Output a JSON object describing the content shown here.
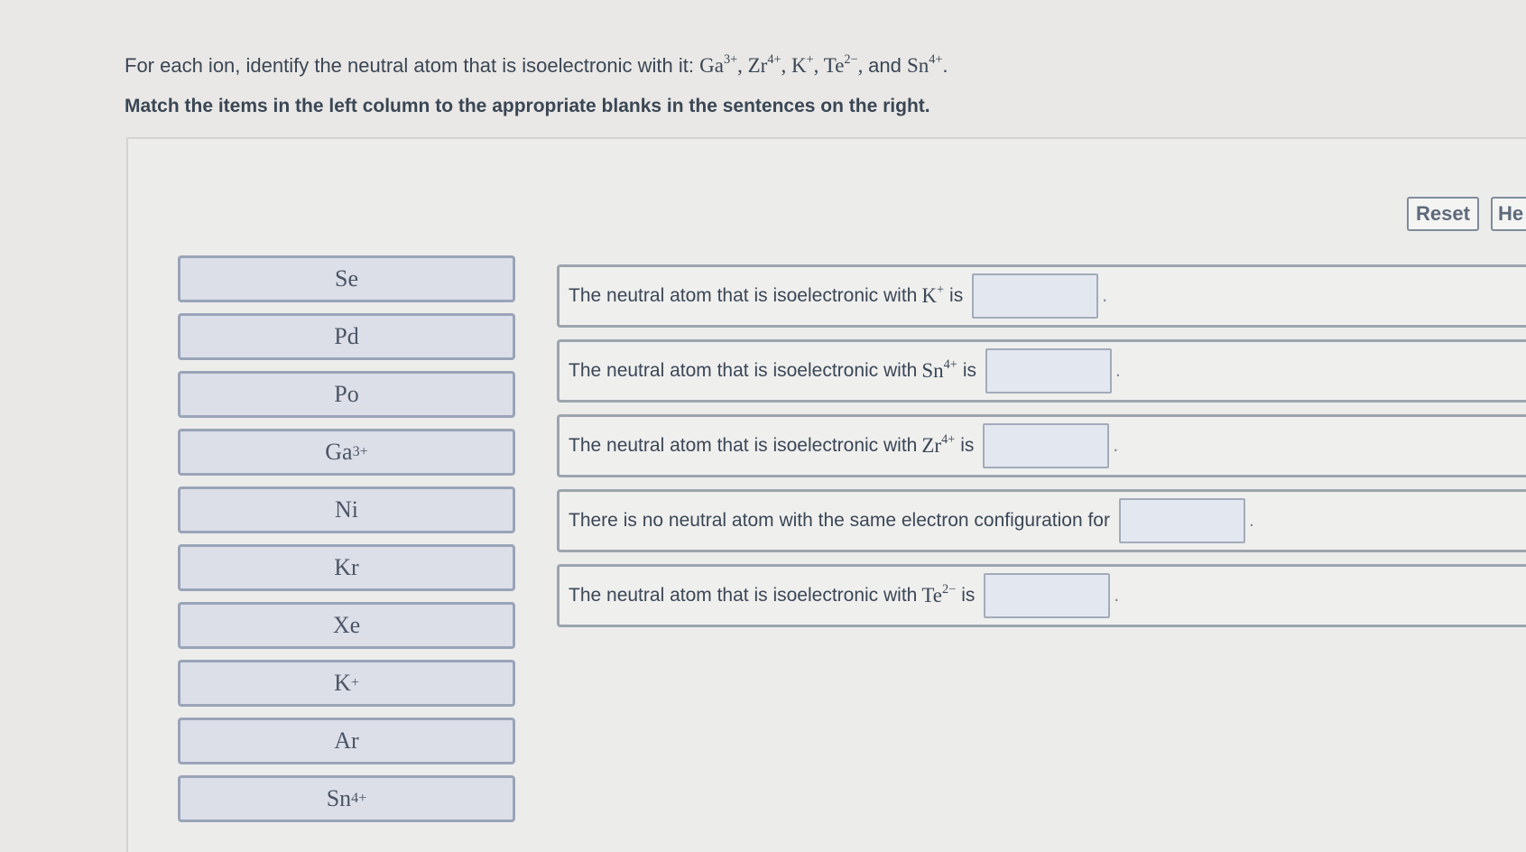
{
  "prompt": {
    "lead": "For each ion, identify the neutral atom that is isoelectronic with it:",
    "ions": [
      {
        "base": "Ga",
        "charge": "3+"
      },
      {
        "base": "Zr",
        "charge": "4+"
      },
      {
        "base": "K",
        "charge": "+"
      },
      {
        "base": "Te",
        "charge": "2−"
      },
      {
        "base": "Sn",
        "charge": "4+"
      }
    ],
    "and_word": "and"
  },
  "instruction": "Match the items in the left column to the appropriate blanks in the sentences on the right.",
  "toolbar": {
    "reset_label": "Reset",
    "help_label": "He"
  },
  "chips": [
    {
      "base": "Se",
      "charge": ""
    },
    {
      "base": "Pd",
      "charge": ""
    },
    {
      "base": "Po",
      "charge": ""
    },
    {
      "base": "Ga",
      "charge": "3+"
    },
    {
      "base": "Ni",
      "charge": ""
    },
    {
      "base": "Kr",
      "charge": ""
    },
    {
      "base": "Xe",
      "charge": ""
    },
    {
      "base": "K",
      "charge": "+"
    },
    {
      "base": "Ar",
      "charge": ""
    },
    {
      "base": "Sn",
      "charge": "4+"
    }
  ],
  "sentences": [
    {
      "prefix": "The neutral atom that is isoelectronic with",
      "ion_base": "K",
      "ion_charge": "+",
      "suffix": "is",
      "blank_value": ""
    },
    {
      "prefix": "The neutral atom that is isoelectronic with",
      "ion_base": "Sn",
      "ion_charge": "4+",
      "suffix": "is",
      "blank_value": ""
    },
    {
      "prefix": "The neutral atom that is isoelectronic with",
      "ion_base": "Zr",
      "ion_charge": "4+",
      "suffix": "is",
      "blank_value": ""
    },
    {
      "prefix": "There is no neutral atom with the same electron configuration for",
      "ion_base": "",
      "ion_charge": "",
      "suffix": "",
      "blank_value": ""
    },
    {
      "prefix": "The neutral atom that is isoelectronic with",
      "ion_base": "Te",
      "ion_charge": "2−",
      "suffix": "is",
      "blank_value": ""
    }
  ],
  "sentence_end": "."
}
